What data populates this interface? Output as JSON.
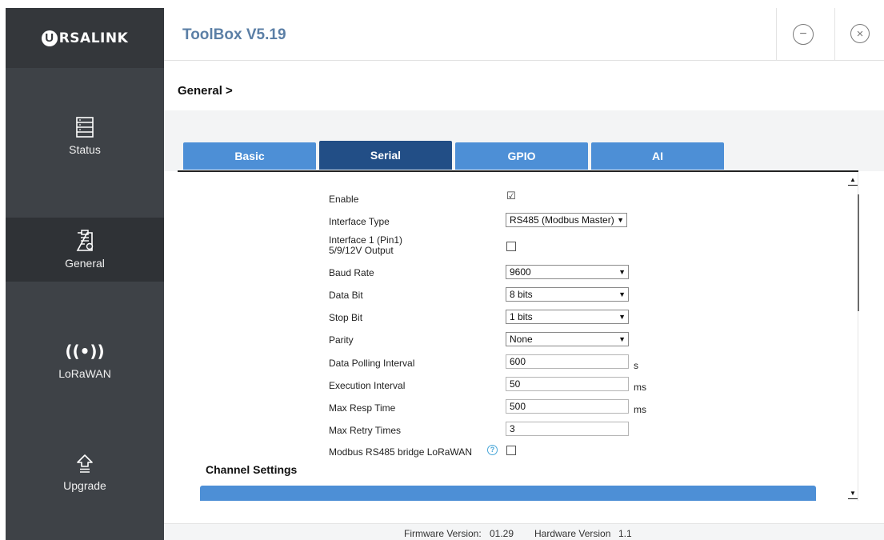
{
  "app": {
    "logo_mark": "U",
    "logo_text": "RSALINK",
    "title": "ToolBox V5.19",
    "minimize_symbol": "−",
    "close_symbol": "×"
  },
  "sidebar": {
    "items": [
      {
        "label": "Status",
        "icon": "status-icon"
      },
      {
        "label": "General",
        "icon": "general-icon"
      },
      {
        "label": "LoRaWAN",
        "icon": "lorawan-icon",
        "glyph": "((•))"
      },
      {
        "label": "Upgrade",
        "icon": "upgrade-icon"
      }
    ],
    "active": "General"
  },
  "breadcrumb": "General >",
  "tabs": [
    {
      "label": "Basic"
    },
    {
      "label": "Serial"
    },
    {
      "label": "GPIO"
    },
    {
      "label": "AI"
    }
  ],
  "active_tab": "Serial",
  "form": {
    "enable": {
      "label": "Enable",
      "checked": true
    },
    "interface_type": {
      "label": "Interface Type",
      "value": "RS485 (Modbus Master)"
    },
    "interface_power": {
      "label_line1": "Interface 1 (Pin1)",
      "label_line2": "5/9/12V Output",
      "checked": false
    },
    "baud_rate": {
      "label": "Baud Rate",
      "value": "9600"
    },
    "data_bit": {
      "label": "Data Bit",
      "value": "8 bits"
    },
    "stop_bit": {
      "label": "Stop Bit",
      "value": "1 bits"
    },
    "parity": {
      "label": "Parity",
      "value": "None"
    },
    "polling_interval": {
      "label": "Data Polling Interval",
      "value": "600",
      "unit": "s"
    },
    "execution_interval": {
      "label": "Execution Interval",
      "value": "50",
      "unit": "ms"
    },
    "max_resp_time": {
      "label": "Max Resp Time",
      "value": "500",
      "unit": "ms"
    },
    "max_retry_times": {
      "label": "Max Retry Times",
      "value": "3"
    },
    "modbus_bridge": {
      "label": "Modbus RS485 bridge LoRaWAN",
      "checked": false,
      "help": "?"
    }
  },
  "channel_settings": {
    "title": "Channel Settings"
  },
  "footer": {
    "firmware_label": "Firmware Version:",
    "firmware_value": "01.29",
    "hardware_label": "Hardware Version",
    "hardware_value": "1.1"
  },
  "colors": {
    "sidebar_bg": "#3e4247",
    "tab_bg": "#4d8fd6",
    "tab_active_bg": "#224e86",
    "title_color": "#5b7fa6",
    "help_color": "#48a6d8"
  }
}
